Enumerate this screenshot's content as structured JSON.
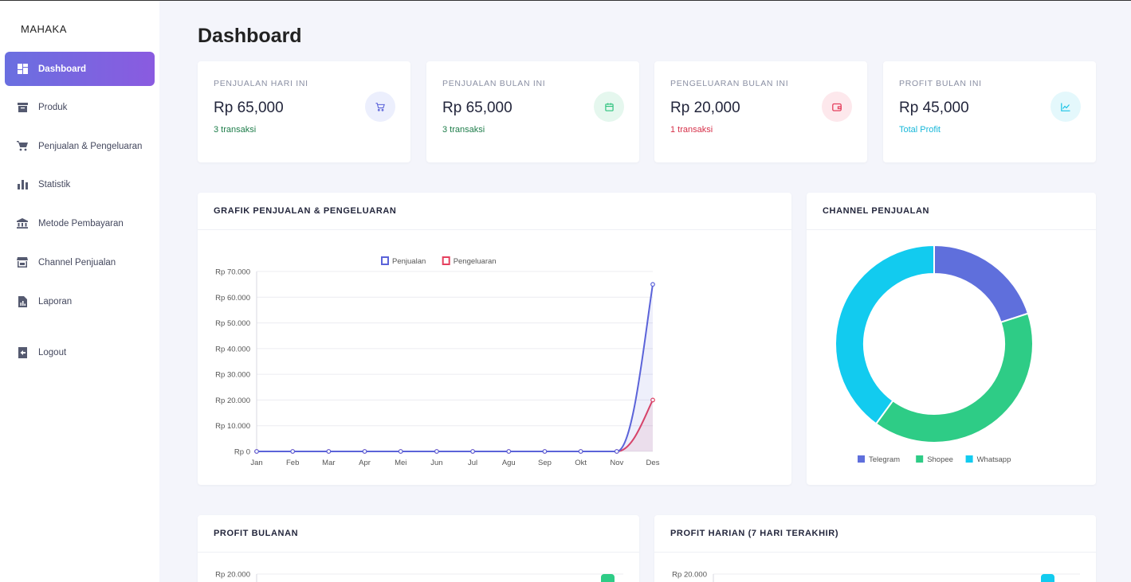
{
  "brand": "MAHAKA",
  "nav": [
    {
      "label": "Dashboard",
      "icon": "dashboard-icon",
      "active": true
    },
    {
      "label": "Produk",
      "icon": "archive-box-icon"
    },
    {
      "label": "Penjualan & Pengeluaran",
      "icon": "cart-icon"
    },
    {
      "label": "Statistik",
      "icon": "bar-chart-icon"
    },
    {
      "label": "Metode Pembayaran",
      "icon": "bank-icon"
    },
    {
      "label": "Channel Penjualan",
      "icon": "store-icon"
    },
    {
      "label": "Laporan",
      "icon": "report-file-icon"
    },
    {
      "label": "Logout",
      "icon": "logout-icon"
    }
  ],
  "page_title": "Dashboard",
  "stats": [
    {
      "label": "PENJUALAN HARI INI",
      "value": "Rp 65,000",
      "sub": "3 transaksi",
      "sub_color": "#1e7d4a",
      "icon": "cart-icon",
      "icon_bg": "#eceffd",
      "icon_color": "#5b63d9"
    },
    {
      "label": "PENJUALAN BULAN INI",
      "value": "Rp 65,000",
      "sub": "3 transaksi",
      "sub_color": "#1e7d4a",
      "icon": "calendar-icon",
      "icon_bg": "#e5f7ee",
      "icon_color": "#2ec27e"
    },
    {
      "label": "PENGELUARAN BULAN INI",
      "value": "Rp 20,000",
      "sub": "1 transaksi",
      "sub_color": "#d63049",
      "icon": "wallet-icon",
      "icon_bg": "#fde8ec",
      "icon_color": "#e5405e"
    },
    {
      "label": "PROFIT BULAN INI",
      "value": "Rp 45,000",
      "sub": "Total Profit",
      "sub_color": "#17b7d9",
      "icon": "trend-chart-icon",
      "icon_bg": "#e4f8fc",
      "icon_color": "#18c3e6"
    }
  ],
  "panels": {
    "sales_chart_title": "GRAFIK PENJUALAN & PENGELUARAN",
    "channel_title": "CHANNEL PENJUALAN",
    "profit_monthly_title": "PROFIT BULANAN",
    "profit_daily_title": "PROFIT HARIAN (7 HARI TERAKHIR)"
  },
  "chart_data": [
    {
      "type": "line",
      "title": "GRAFIK PENJUALAN & PENGELUARAN",
      "x": [
        "Jan",
        "Feb",
        "Mar",
        "Apr",
        "Mei",
        "Jun",
        "Jul",
        "Agu",
        "Sep",
        "Okt",
        "Nov",
        "Des"
      ],
      "yticks": [
        "Rp 0",
        "Rp 10.000",
        "Rp 20.000",
        "Rp 30.000",
        "Rp 40.000",
        "Rp 50.000",
        "Rp 60.000",
        "Rp 70.000"
      ],
      "ylim": [
        0,
        70000
      ],
      "series": [
        {
          "name": "Penjualan",
          "color": "#5b63d9",
          "values": [
            0,
            0,
            0,
            0,
            0,
            0,
            0,
            0,
            0,
            0,
            0,
            65000
          ]
        },
        {
          "name": "Pengeluaran",
          "color": "#e5405e",
          "values": [
            0,
            0,
            0,
            0,
            0,
            0,
            0,
            0,
            0,
            0,
            0,
            20000
          ]
        }
      ],
      "legend": "top"
    },
    {
      "type": "pie",
      "title": "CHANNEL PENJUALAN",
      "categories": [
        "Telegram",
        "Shopee",
        "Whatsapp"
      ],
      "values": [
        1,
        2,
        2
      ],
      "colors": [
        "#5f6fdc",
        "#2ecc86",
        "#12cbef"
      ],
      "legend": "bottom"
    },
    {
      "type": "bar",
      "title": "PROFIT BULANAN",
      "yticks": [
        "Rp 20.000"
      ],
      "color": "#2ecc86"
    },
    {
      "type": "bar",
      "title": "PROFIT HARIAN (7 HARI TERAKHIR)",
      "yticks": [
        "Rp 20.000"
      ],
      "color": "#12cbef"
    }
  ]
}
